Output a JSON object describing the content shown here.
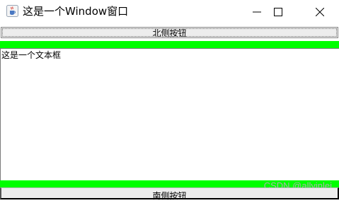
{
  "window": {
    "title": "这是一个Window窗口",
    "icon": "java-cup-icon",
    "controls": [
      "minimize-icon",
      "maximize-icon",
      "close-icon"
    ]
  },
  "north_button": {
    "label": "北侧按钮"
  },
  "text_area": {
    "value": "这是一个文本框"
  },
  "south_button": {
    "label": "南侧按钮"
  },
  "watermark": {
    "text": "CSDN @allyinlei"
  },
  "colors": {
    "accent_green": "#00ff00"
  }
}
